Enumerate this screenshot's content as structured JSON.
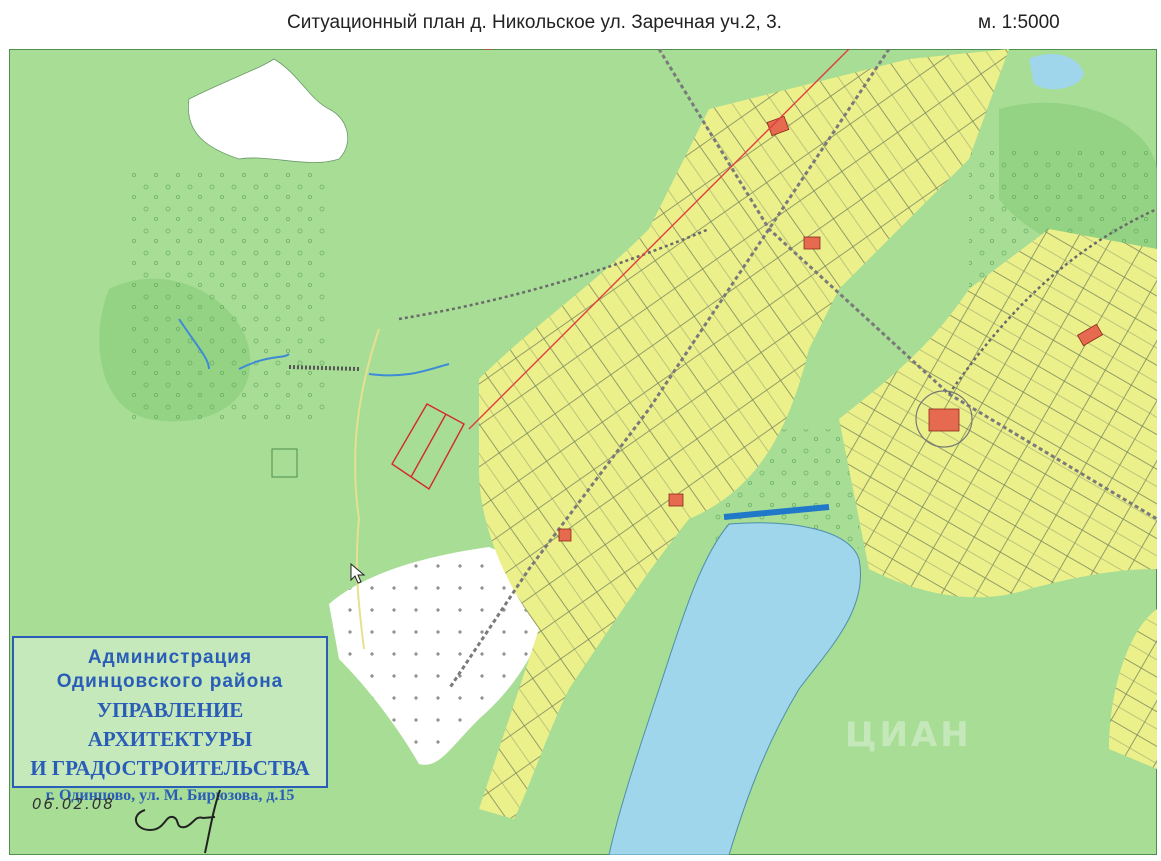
{
  "header": {
    "title": "Ситуационный план д. Никольское  ул. Заречная  уч.2, 3.",
    "scale": "м.  1:5000"
  },
  "stamp": {
    "line1": "Администрация",
    "line2": "Одинцовского района",
    "line3": "УПРАВЛЕНИЕ АРХИТЕКТУРЫ",
    "line4": "И ГРАДОСТРОИТЕЛЬСТВА",
    "line5": "г. Одинцово, ул. М. Бирюзова, д.15",
    "color": "#2a5db8"
  },
  "annotation": {
    "date": "06.02.08"
  },
  "watermark": "ЦИАН",
  "colors": {
    "meadow": "#9fd98e",
    "village_plots": "#ecf08a",
    "water": "#9fd6ec",
    "buildings": "#e66a50",
    "plot_outline": "#d42a2a"
  },
  "icons": {
    "cursor": "mouse-pointer-icon",
    "signature": "signature-icon"
  }
}
